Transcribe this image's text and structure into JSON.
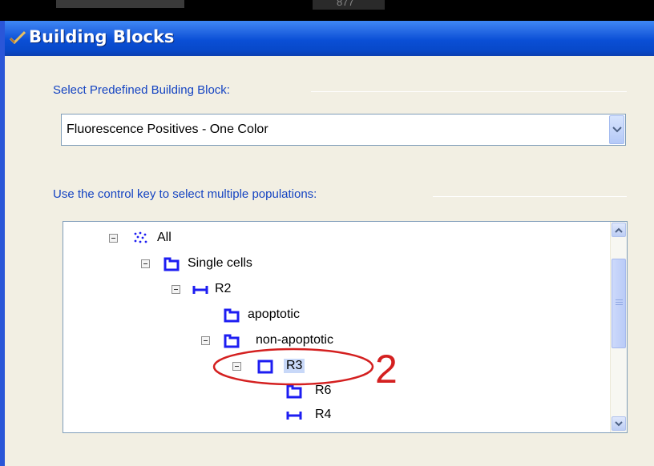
{
  "background": {
    "top_number": "877"
  },
  "window": {
    "title": "Building Blocks",
    "title_icon": "checkmark-icon"
  },
  "predefined": {
    "label": "Select Predefined Building Block:",
    "selected_value": "Fluorescence Positives - One Color",
    "dropdown_icon": "chevron-down-icon"
  },
  "populations": {
    "label": "Use the control key to select multiple populations:",
    "tree": [
      {
        "label": "All",
        "icon": "all-events-icon",
        "level": 0,
        "expanded": true
      },
      {
        "label": "Single cells",
        "icon": "polygon-gate-icon",
        "level": 1,
        "expanded": true
      },
      {
        "label": "R2",
        "icon": "range-gate-icon",
        "level": 2,
        "expanded": true
      },
      {
        "label": "apoptotic",
        "icon": "polygon-gate-icon",
        "level": 3,
        "expanded": null
      },
      {
        "label": "non-apoptotic",
        "icon": "polygon-gate-icon",
        "level": 3,
        "expanded": true
      },
      {
        "label": "R3",
        "icon": "rectangle-gate-icon",
        "level": 4,
        "expanded": true,
        "highlighted": true
      },
      {
        "label": "R6",
        "icon": "polygon-gate-icon",
        "level": 5,
        "expanded": null
      },
      {
        "label": "R4",
        "icon": "range-gate-icon",
        "level": 5,
        "expanded": null
      }
    ]
  },
  "annotation": {
    "step_number": "2",
    "color": "#d42020"
  },
  "colors": {
    "title_bar": "#0a4fd6",
    "label_text": "#1544c2",
    "dialog_background": "#f2efe3",
    "gate_icon": "#1d1df2"
  }
}
